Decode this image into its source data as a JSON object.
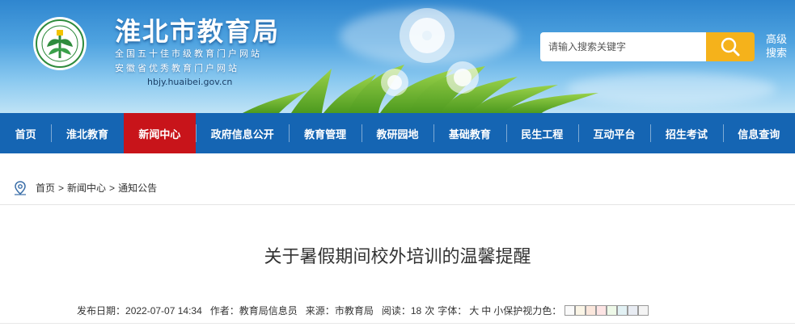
{
  "header": {
    "site_title": "淮北市教育局",
    "subtitle_1": "全国五十佳市级教育门户网站",
    "subtitle_2": "安徽省优秀教育门户网站",
    "domain": "hbjy.huaibei.gov.cn",
    "search_placeholder": "请输入搜索关键字",
    "advanced_search": "高级搜索"
  },
  "nav": {
    "items": [
      {
        "label": "首页",
        "active": false
      },
      {
        "label": "淮北教育",
        "active": false
      },
      {
        "label": "新闻中心",
        "active": true
      },
      {
        "label": "政府信息公开",
        "active": false
      },
      {
        "label": "教育管理",
        "active": false
      },
      {
        "label": "教研园地",
        "active": false
      },
      {
        "label": "基础教育",
        "active": false
      },
      {
        "label": "民生工程",
        "active": false
      },
      {
        "label": "互动平台",
        "active": false
      },
      {
        "label": "招生考试",
        "active": false
      },
      {
        "label": "信息查询",
        "active": false
      }
    ]
  },
  "breadcrumb": {
    "items": [
      "首页",
      "新闻中心",
      "通知公告"
    ],
    "separator": ">"
  },
  "article": {
    "title": "关于暑假期间校外培训的温馨提醒",
    "meta": {
      "date_label": "发布日期：",
      "date": "2022-07-07 14:34",
      "author_label": "作者：",
      "author": "教育局信息员",
      "source_label": "来源：",
      "source": "市教育局",
      "reads_label": "阅读：",
      "reads": "18",
      "reads_unit": "次",
      "font_label": "字体：",
      "font_sizes": [
        "大",
        "中",
        "小"
      ],
      "color_label": "保护视力色："
    },
    "eye_colors": [
      "#fafafa",
      "#fbf5e6",
      "#fbe7dc",
      "#fde4e4",
      "#eef9e8",
      "#e2f1f4",
      "#e8ecf3",
      "#f4f4f4"
    ]
  },
  "colors": {
    "nav_bg": "#1565b3",
    "nav_active": "#c8141a",
    "search_button": "#f5b21b"
  }
}
